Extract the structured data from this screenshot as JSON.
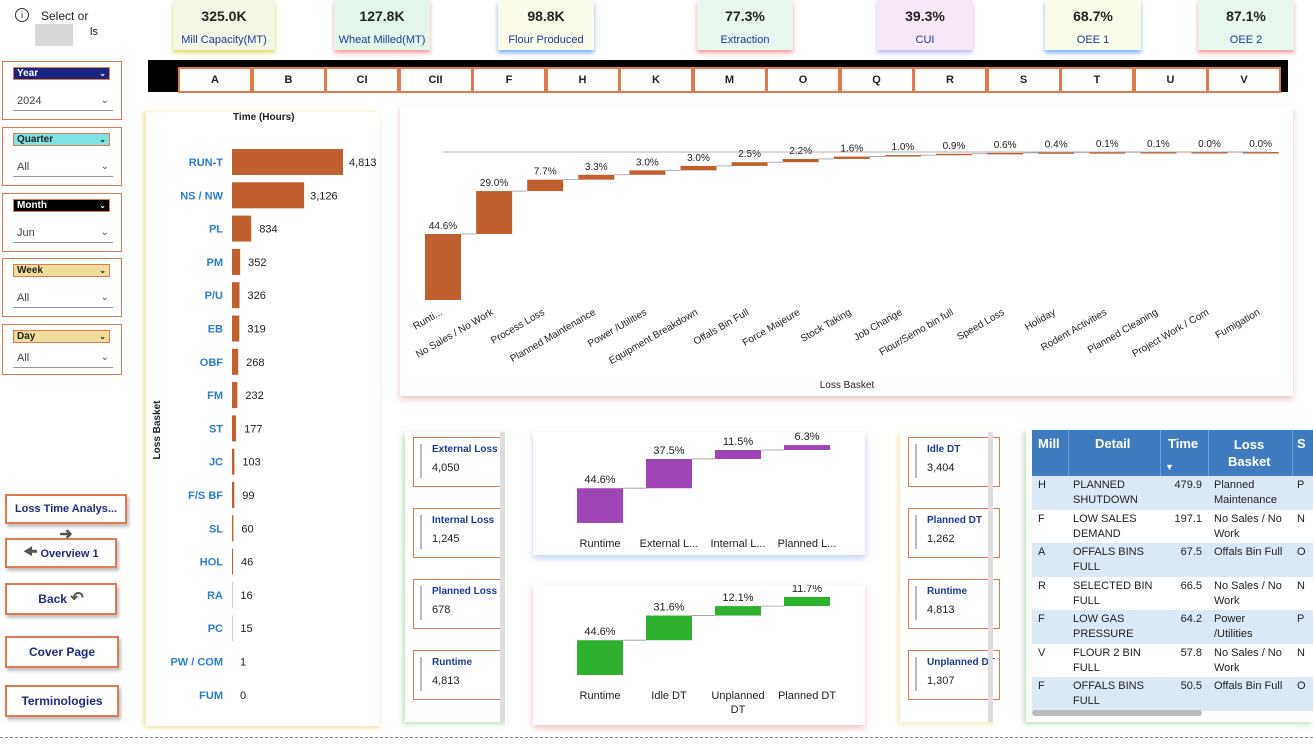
{
  "kpis": [
    {
      "value": "325.0K",
      "label": "Mill Capacity(MT)"
    },
    {
      "value": "127.8K",
      "label": "Wheat Milled(MT)"
    },
    {
      "value": "98.8K",
      "label": "Flour Produced"
    },
    {
      "value": "77.3%",
      "label": "Extraction"
    },
    {
      "value": "39.3%",
      "label": "CUI"
    },
    {
      "value": "68.7%",
      "label": "OEE 1"
    },
    {
      "value": "87.1%",
      "label": "OEE 2"
    }
  ],
  "info": {
    "icon": "info-icon",
    "line1": "Select or",
    "line2": "ls"
  },
  "filters": [
    {
      "label": "Year",
      "value": "2024",
      "color": "#1a237e"
    },
    {
      "label": "Quarter",
      "value": "All",
      "color": "#7fe3e6"
    },
    {
      "label": "Month",
      "value": "Jun",
      "color": "#000000"
    },
    {
      "label": "Week",
      "value": "All",
      "color": "#f0dd9a"
    },
    {
      "label": "Day",
      "value": "All",
      "color": "#f0dd9a"
    }
  ],
  "nav": {
    "loss_time": "Loss Time Analys...",
    "overview": "Overview 1",
    "back": "Back",
    "cover": "Cover Page",
    "terminologies": "Terminologies"
  },
  "tabs": [
    "A",
    "B",
    "CI",
    "CII",
    "F",
    "H",
    "K",
    "M",
    "O",
    "Q",
    "R",
    "S",
    "T",
    "U",
    "V"
  ],
  "loss_side_cards": [
    {
      "title": "External Loss",
      "value": "4,050"
    },
    {
      "title": "Internal Loss",
      "value": "1,245"
    },
    {
      "title": "Planned Loss",
      "value": "678"
    },
    {
      "title": "Runtime",
      "value": "4,813"
    }
  ],
  "dt_side_cards": [
    {
      "title": "Idle DT",
      "value": "3,404"
    },
    {
      "title": "Planned DT",
      "value": "1,262"
    },
    {
      "title": "Runtime",
      "value": "4,813"
    },
    {
      "title": "Unplanned DT",
      "value": "1,307"
    }
  ],
  "chart_data": [
    {
      "type": "bar",
      "orientation": "horizontal",
      "title": "Time (Hours)",
      "ylabel": "Loss Basket",
      "color": "#c0602f",
      "categories": [
        "RUN-T",
        "NS / NW",
        "PL",
        "PM",
        "P/U",
        "EB",
        "OBF",
        "FM",
        "ST",
        "JC",
        "F/S BF",
        "SL",
        "HOL",
        "RA",
        "PC",
        "PW / COM",
        "FUM"
      ],
      "values": [
        4813,
        3126,
        834,
        352,
        326,
        319,
        268,
        232,
        177,
        103,
        99,
        60,
        46,
        16,
        15,
        1,
        0
      ],
      "value_labels": [
        "4,813",
        "3,126",
        "834",
        "352",
        "326",
        "319",
        "268",
        "232",
        "177",
        "103",
        "99",
        "60",
        "46",
        "16",
        "15",
        "1",
        "0"
      ]
    },
    {
      "type": "waterfall",
      "xlabel": "Loss Basket",
      "color": "#c0602f",
      "categories": [
        "Runti...",
        "No Sales / No Work",
        "Process Loss",
        "Planned Maintenance",
        "Power /Utilities",
        "Equipment Breakdown",
        "Offals Bin Full",
        "Force Majeure",
        "Stock Taking",
        "Job Change",
        "Flour/Semo bin full",
        "Speed Loss",
        "Holiday",
        "Rodent Activities",
        "Planned Cleaning",
        "Project Work / Com",
        "Fumigation"
      ],
      "values": [
        44.6,
        29.0,
        7.7,
        3.3,
        3.0,
        3.0,
        2.5,
        2.2,
        1.6,
        1.0,
        0.9,
        0.6,
        0.4,
        0.1,
        0.1,
        0.0,
        0.0
      ],
      "labels": [
        "44.6%",
        "29.0%",
        "7.7%",
        "3.3%",
        "3.0%",
        "3.0%",
        "2.5%",
        "2.2%",
        "1.6%",
        "1.0%",
        "0.9%",
        "0.6%",
        "0.4%",
        "0.1%",
        "0.1%",
        "0.0%",
        "0.0%"
      ]
    },
    {
      "type": "waterfall",
      "color": "#a045b5",
      "categories": [
        "Runtime",
        "External L...",
        "Internal L...",
        "Planned L..."
      ],
      "values": [
        44.6,
        37.5,
        11.5,
        6.3
      ],
      "labels": [
        "44.6%",
        "37.5%",
        "11.5%",
        "6.3%"
      ]
    },
    {
      "type": "waterfall",
      "color": "#2fb02f",
      "categories": [
        "Runtime",
        "Idle DT",
        "Unplanned DT",
        "Planned DT"
      ],
      "values": [
        44.6,
        31.6,
        12.1,
        11.7
      ],
      "labels": [
        "44.6%",
        "31.6%",
        "12.1%",
        "11.7%"
      ]
    }
  ],
  "table": {
    "headers": [
      "Mill",
      "Detail",
      "Time",
      "Loss Basket",
      "S"
    ],
    "rows": [
      {
        "mill": "H",
        "detail": "PLANNED SHUTDOWN",
        "time": "479.9",
        "basket": "Planned Maintenance",
        "s": "P"
      },
      {
        "mill": "F",
        "detail": "LOW SALES DEMAND",
        "time": "197.1",
        "basket": "No Sales / No Work",
        "s": "N"
      },
      {
        "mill": "A",
        "detail": "OFFALS BINS FULL",
        "time": "67.5",
        "basket": "Offals Bin Full",
        "s": "O"
      },
      {
        "mill": "R",
        "detail": "SELECTED BIN FULL",
        "time": "66.5",
        "basket": "No Sales / No Work",
        "s": "N"
      },
      {
        "mill": "F",
        "detail": "LOW GAS PRESSURE",
        "time": "64.2",
        "basket": "Power /Utilities",
        "s": "P"
      },
      {
        "mill": "V",
        "detail": "FLOUR 2 BIN FULL",
        "time": "57.8",
        "basket": "No Sales / No Work",
        "s": "N"
      },
      {
        "mill": "F",
        "detail": "OFFALS BINS FULL",
        "time": "50.5",
        "basket": "Offals Bin Full",
        "s": "O"
      }
    ]
  }
}
